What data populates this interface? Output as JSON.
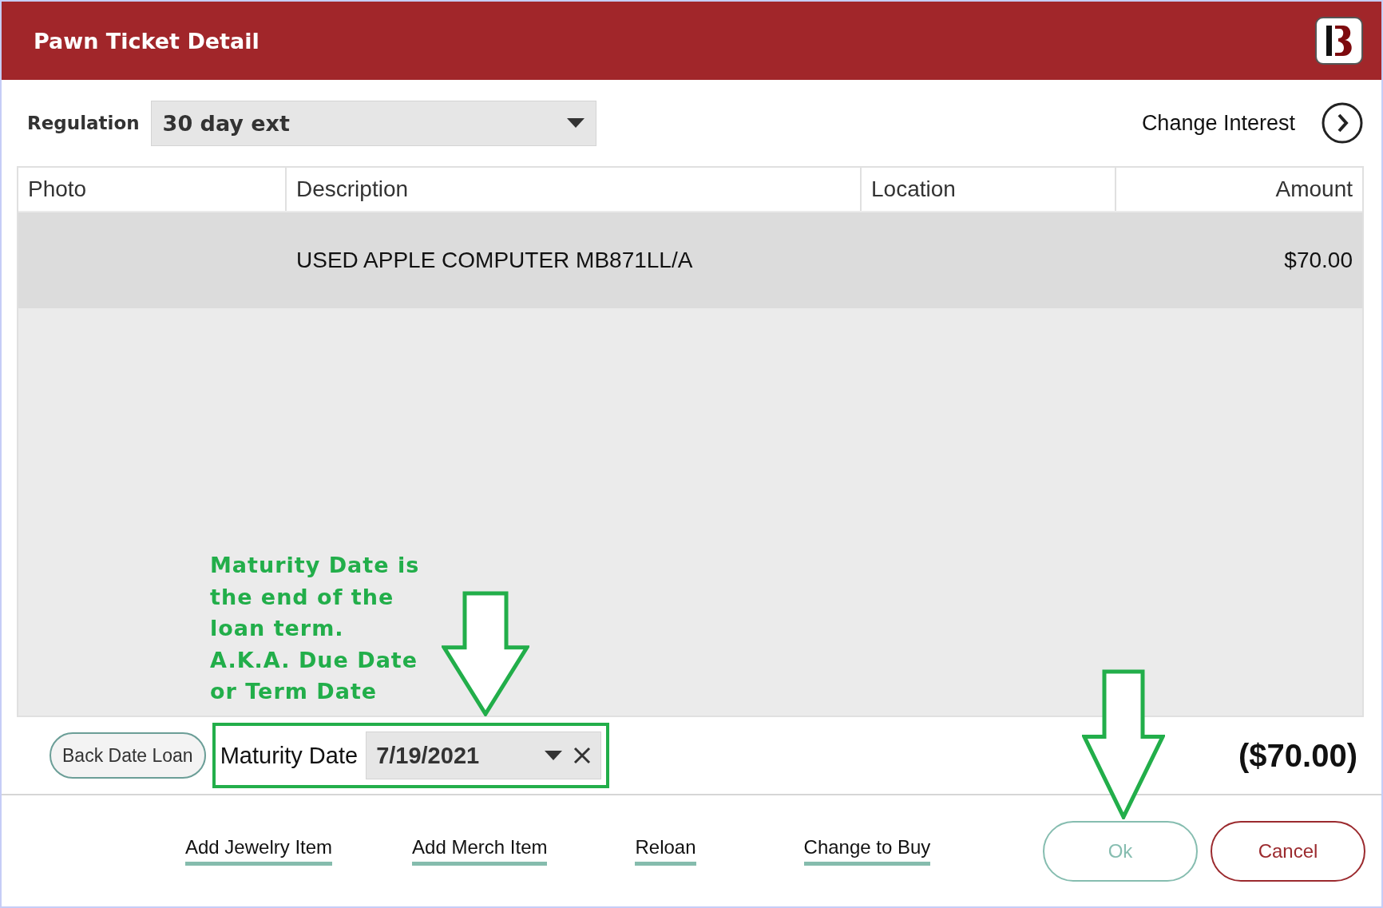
{
  "window": {
    "title": "Pawn Ticket Detail"
  },
  "regulation": {
    "label": "Regulation",
    "value": "30 day ext"
  },
  "change_interest": {
    "label": "Change Interest"
  },
  "table": {
    "columns": [
      "Photo",
      "Description",
      "Location",
      "Amount"
    ],
    "rows": [
      {
        "description": "USED APPLE COMPUTER MB871LL/A",
        "amount": "$70.00",
        "selected": true
      }
    ]
  },
  "back_date_button": {
    "label": "Back Date Loan"
  },
  "maturity_date": {
    "label": "Maturity Date",
    "value": "7/19/2021"
  },
  "total": "($70.00)",
  "actions": [
    "Add Jewelry Item",
    "Add Merch Item",
    "Reloan",
    "Change to Buy"
  ],
  "buttons": [
    {
      "label": "Ok",
      "kind": "primary"
    },
    {
      "label": "Cancel",
      "kind": "cancel"
    }
  ],
  "annotation": {
    "lines": [
      "Maturity Date is",
      "the end of the",
      "loan term.",
      "A.K.A. Due Date",
      "or Term Date"
    ]
  }
}
